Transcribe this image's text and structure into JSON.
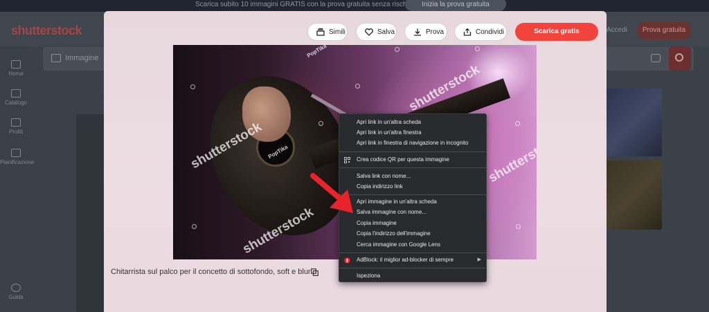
{
  "banner": {
    "text": "Scarica subito 10 immagini GRATIS con la prova gratuita senza rischi.",
    "cta": "Inizia la prova gratuita"
  },
  "header": {
    "logo": "shutterstock",
    "login": "Accedi",
    "trial": "Prova gratuita"
  },
  "sidebar": {
    "items": [
      {
        "label": "Home"
      },
      {
        "label": "Catalogo"
      },
      {
        "label": "Profili"
      },
      {
        "label": "Pianificazione"
      },
      {
        "label": "Guida"
      }
    ]
  },
  "search": {
    "placeholder": "Immagine"
  },
  "modal": {
    "buttons": {
      "simili": "Simili",
      "salva": "Salva",
      "prova": "Prova",
      "condividi": "Condividi",
      "download": "Scarica gratis"
    },
    "image": {
      "watermark": "shutterstock",
      "credit": "PopTika"
    },
    "caption": "Chitarrista sul palco per il concetto di sottofondo, soft e blur"
  },
  "context_menu": {
    "groups": [
      [
        "Apri link in un'altra scheda",
        "Apri link in un'altra finestra",
        "Apri link in finestra di navigazione in incognito"
      ],
      [
        "Crea codice QR per questa immagine"
      ],
      [
        "Salva link con nome...",
        "Copia indirizzo link"
      ],
      [
        "Apri immagine in un'altra scheda",
        "Salva immagine con nome...",
        "Copia immagine",
        "Copia l'indirizzo dell'immagine",
        "Cerca immagine con Google Lens"
      ],
      [
        "AdBlock: il miglior ad-blocker di sempre"
      ],
      [
        "Ispeziona"
      ]
    ]
  },
  "colors": {
    "accent": "#f2433d",
    "menu_bg": "#292a2d",
    "arrow": "#e8232a"
  }
}
